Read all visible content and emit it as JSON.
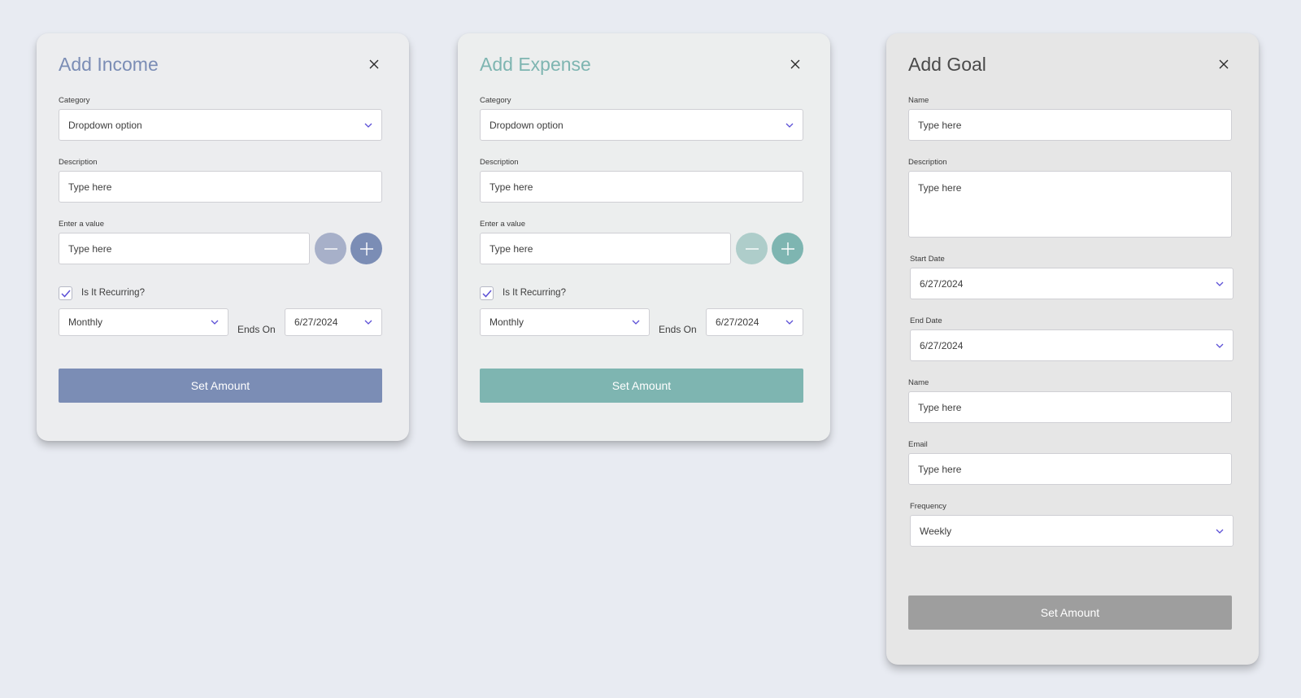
{
  "colors": {
    "income_accent": "#7b8db5",
    "income_accent_light": "#a7b0c9",
    "expense_accent": "#7eb5b1",
    "expense_accent_light": "#aecdca",
    "goal_button": "#9e9e9e",
    "goal_title": "#4a4a4a",
    "chevron": "#5b4fd6",
    "checkmark": "#5b4fd6"
  },
  "income": {
    "title": "Add Income",
    "close_icon": "close-icon",
    "category_label": "Category",
    "category_value": "Dropdown option",
    "description_label": "Description",
    "description_placeholder": "Type here",
    "value_label": "Enter a value",
    "value_placeholder": "Type here",
    "recurring_label": "Is It Recurring?",
    "recurring_checked": true,
    "frequency_value": "Monthly",
    "ends_on_label": "Ends On",
    "end_date_value": "6/27/2024",
    "submit_label": "Set Amount"
  },
  "expense": {
    "title": "Add Expense",
    "close_icon": "close-icon",
    "category_label": "Category",
    "category_value": "Dropdown option",
    "description_label": "Description",
    "description_placeholder": "Type here",
    "value_label": "Enter a value",
    "value_placeholder": "Type here",
    "recurring_label": "Is It Recurring?",
    "recurring_checked": true,
    "frequency_value": "Monthly",
    "ends_on_label": "Ends On",
    "end_date_value": "6/27/2024",
    "submit_label": "Set Amount"
  },
  "goal": {
    "title": "Add Goal",
    "close_icon": "close-icon",
    "name_label": "Name",
    "name_placeholder": "Type here",
    "description_label": "Description",
    "description_placeholder": "Type here",
    "start_date_label": "Start Date",
    "start_date_value": "6/27/2024",
    "end_date_label": "End Date",
    "end_date_value": "6/27/2024",
    "name2_label": "Name",
    "name2_placeholder": "Type here",
    "email_label": "Email",
    "email_placeholder": "Type here",
    "frequency_label": "Frequency",
    "frequency_value": "Weekly",
    "submit_label": "Set Amount"
  }
}
